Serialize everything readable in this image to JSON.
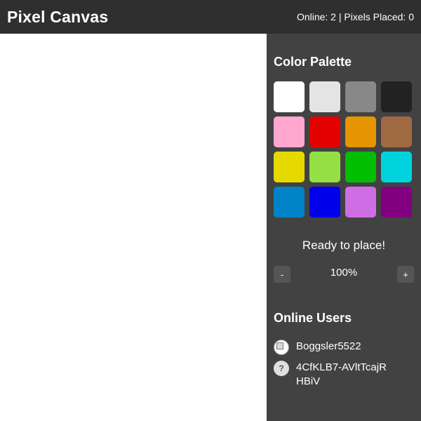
{
  "header": {
    "title": "Pixel Canvas",
    "stats": "Online: 2 | Pixels Placed: 0"
  },
  "palette": {
    "title": "Color Palette",
    "colors": [
      "#ffffff",
      "#e4e4e4",
      "#888888",
      "#222222",
      "#ffa7d1",
      "#e50000",
      "#e59500",
      "#a06a42",
      "#e5d900",
      "#94e044",
      "#02be01",
      "#00d3dd",
      "#0083c7",
      "#0000ea",
      "#cf6ee4",
      "#820080"
    ]
  },
  "status": "Ready to place!",
  "zoom": {
    "out_label": "-",
    "in_label": "+",
    "level": "100%"
  },
  "users": {
    "title": "Online Users",
    "list": [
      {
        "name": "Boggsler5522",
        "avatar": "image"
      },
      {
        "name": "4CfKLB7-AVltTcajRHBiV",
        "avatar": "?"
      }
    ]
  }
}
